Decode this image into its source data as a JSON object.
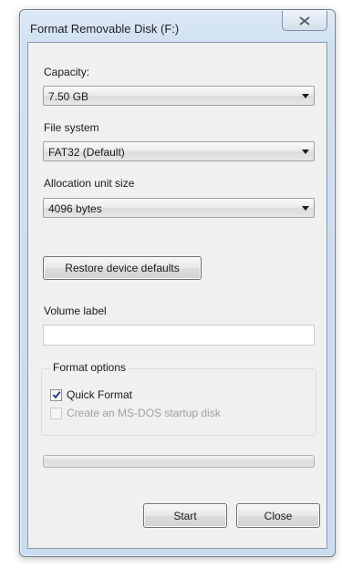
{
  "window": {
    "title": "Format Removable Disk (F:)"
  },
  "capacity": {
    "label": "Capacity:",
    "value": "7.50 GB"
  },
  "file_system": {
    "label": "File system",
    "value": "FAT32 (Default)"
  },
  "allocation": {
    "label": "Allocation unit size",
    "value": "4096 bytes"
  },
  "restore_button": "Restore device defaults",
  "volume_label": {
    "label": "Volume label",
    "value": ""
  },
  "format_options": {
    "title": "Format options",
    "quick_format": {
      "label": "Quick Format",
      "checked": true
    },
    "msdos_startup": {
      "label": "Create an MS-DOS startup disk",
      "checked": false,
      "disabled": true
    }
  },
  "progress": {
    "percent": 0
  },
  "buttons": {
    "start": "Start",
    "close": "Close"
  },
  "icons": {
    "window_close": "close-icon",
    "dropdown": "chevron-down-icon",
    "check": "checkmark-icon"
  }
}
